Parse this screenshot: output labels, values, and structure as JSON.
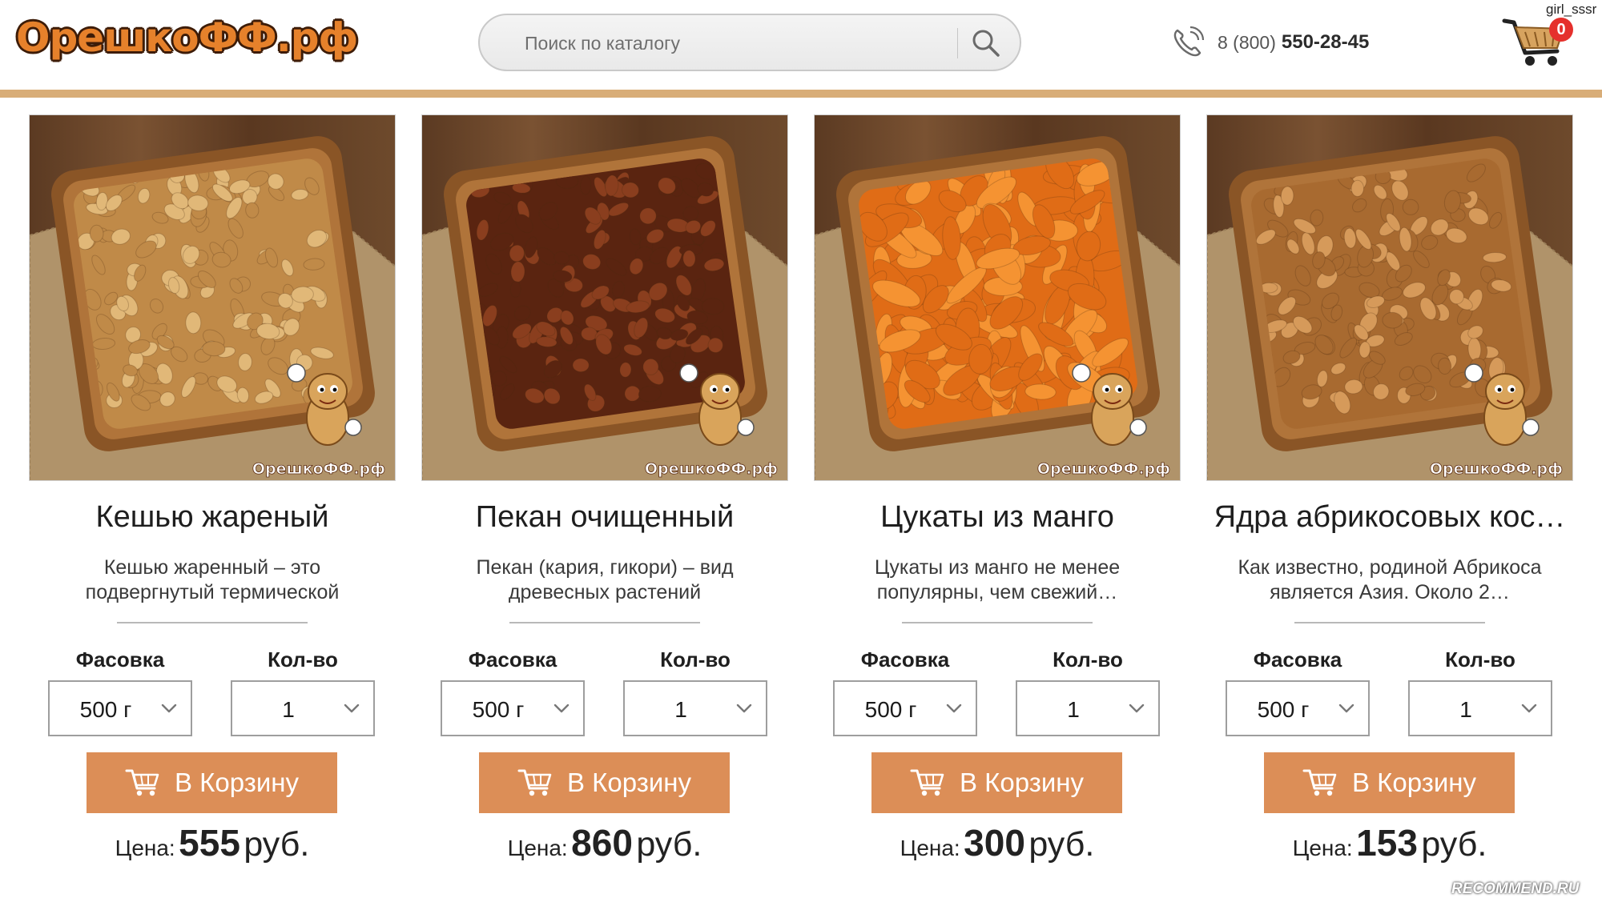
{
  "header": {
    "logo_text": "ОрешкоФФ.рф",
    "search_placeholder": "Поиск по каталогу",
    "phone_prefix": "8 (800)",
    "phone_number": "550-28-45",
    "cart_count": "0",
    "user_watermark": "girl_sssr",
    "colors": {
      "accent": "#dc8e57",
      "header_line": "#d8ad78",
      "logo": "#e6812b",
      "badge": "#e5302c"
    }
  },
  "products": [
    {
      "title": "Кешью жареный",
      "description": "Кешью жаренный – это подвергнутый термической обработке (обжариванию)…",
      "pack_label": "Фасовка",
      "pack_value": "500 г",
      "qty_label": "Кол-во",
      "qty_value": "1",
      "buy_label": "В Корзину",
      "price_label": "Цена:",
      "price_value": "555",
      "price_currency": "руб.",
      "photo_watermark": "ОрешкоФФ.рф",
      "photo_colors": {
        "base": "#e1b878",
        "shade": "#c08a48"
      }
    },
    {
      "title": "Пекан очищенный",
      "description": "Пекан (кария, гикори) – вид древесных растений семейства…",
      "pack_label": "Фасовка",
      "pack_value": "500 г",
      "qty_label": "Кол-во",
      "qty_value": "1",
      "buy_label": "В Корзину",
      "price_label": "Цена:",
      "price_value": "860",
      "price_currency": "руб.",
      "photo_watermark": "ОрешкоФФ.рф",
      "photo_colors": {
        "base": "#8a3e1e",
        "shade": "#5a2410"
      }
    },
    {
      "title": "Цукаты из манго",
      "description": "Цукаты из манго не менее популярны, чем свежий…",
      "pack_label": "Фасовка",
      "pack_value": "500 г",
      "qty_label": "Кол-во",
      "qty_value": "1",
      "buy_label": "В Корзину",
      "price_label": "Цена:",
      "price_value": "300",
      "price_currency": "руб.",
      "photo_watermark": "ОрешкоФФ.рф",
      "photo_colors": {
        "base": "#f59332",
        "shade": "#e06c16"
      }
    },
    {
      "title": "Ядра абрикосовых кос…",
      "description": "Как известно, родиной Абрикоса является Азия. Около 2…",
      "pack_label": "Фасовка",
      "pack_value": "500 г",
      "qty_label": "Кол-во",
      "qty_value": "1",
      "buy_label": "В Корзину",
      "price_label": "Цена:",
      "price_value": "153",
      "price_currency": "руб.",
      "photo_watermark": "ОрешкоФФ.рф",
      "photo_colors": {
        "base": "#d69a5a",
        "shade": "#a86a30"
      }
    }
  ],
  "footer_watermark": "RECOMMEND.RU"
}
